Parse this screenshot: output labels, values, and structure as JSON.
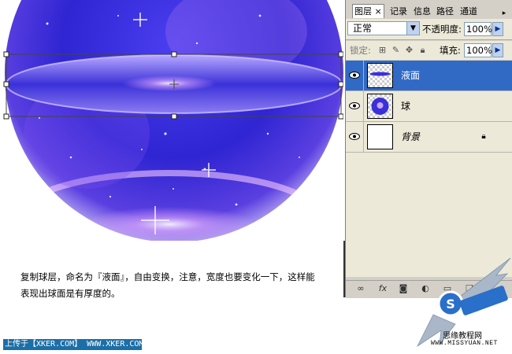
{
  "panel": {
    "tabs": [
      {
        "label": "图层",
        "active": true
      },
      {
        "label": "记录"
      },
      {
        "label": "信息"
      },
      {
        "label": "路径"
      },
      {
        "label": "通道"
      }
    ],
    "tab_close": "×",
    "menu_arrow": "▸",
    "blend_mode": "正常",
    "opacity_label": "不透明度:",
    "opacity_value": "100%",
    "lock_label": "锁定:",
    "fill_label": "填充:",
    "fill_value": "100%"
  },
  "layers": [
    {
      "name": "液面",
      "selected": true,
      "visible": true
    },
    {
      "name": "球",
      "selected": false,
      "visible": true
    },
    {
      "name": "背景",
      "selected": false,
      "visible": true,
      "locked": true
    }
  ],
  "footer_icons": [
    "link-icon",
    "fx-icon",
    "mask-icon",
    "adjustment-icon",
    "folder-icon",
    "new-layer-icon"
  ],
  "caption": {
    "line1": "复制球层，命名为『液面』，自由变换，注意，宽度也要变化一下，这样能",
    "line2": "表现出球面是有厚度的。"
  },
  "credit": "上传于【XKER.COM】 WWW.XKER.COM",
  "logo": {
    "text": "思缘教程网",
    "url": "WWW.MISSYUAN.NET"
  },
  "colors": {
    "selection": "#316ac5",
    "panel": "#d4d0c8",
    "sphere": "#3a2fd8"
  }
}
